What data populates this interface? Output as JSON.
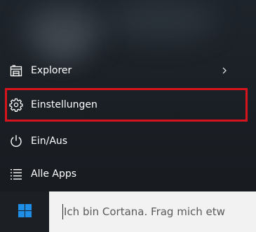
{
  "start_menu": {
    "items": [
      {
        "label": "Explorer",
        "icon": "file-explorer-icon",
        "has_submenu": true
      },
      {
        "label": "Einstellungen",
        "icon": "gear-icon",
        "highlighted": true
      },
      {
        "label": "Ein/Aus",
        "icon": "power-icon"
      },
      {
        "label": "Alle Apps",
        "icon": "all-apps-icon"
      }
    ]
  },
  "taskbar": {
    "start_icon": "windows-logo-icon",
    "search_placeholder": "Ich bin Cortana. Frag mich etw"
  },
  "colors": {
    "menu_background": "#1b2026",
    "text": "#ffffff",
    "highlight_border": "#d6141c",
    "windows_logo": "#1e8ee6",
    "search_background": "#f2f2f2",
    "search_text": "#5a5a5a"
  }
}
